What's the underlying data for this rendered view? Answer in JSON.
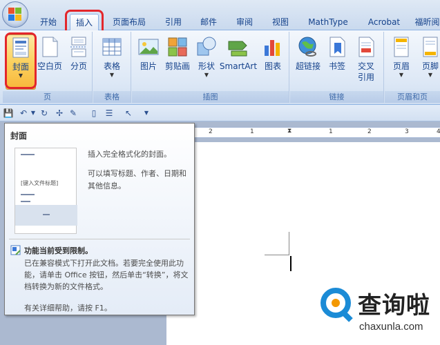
{
  "tabs": {
    "home": "开始",
    "insert": "插入",
    "page_layout": "页面布局",
    "references": "引用",
    "mailings": "邮件",
    "review": "审阅",
    "view": "视图",
    "mathtype": "MathType",
    "acrobat": "Acrobat",
    "foxit": "福昕阅"
  },
  "ribbon": {
    "pages_group": {
      "label": "页",
      "cover": "封面",
      "blank_page": "空白页",
      "page_break": "分页"
    },
    "tables_group": {
      "label": "表格",
      "table": "表格"
    },
    "illustrations_group": {
      "label": "插图",
      "picture": "图片",
      "clip_art": "剪贴画",
      "shapes": "形状",
      "smartart": "SmartArt",
      "chart": "图表"
    },
    "links_group": {
      "label": "链接",
      "hyperlink": "超链接",
      "bookmark": "书签",
      "cross_ref_1": "交叉",
      "cross_ref_2": "引用"
    },
    "header_footer_group": {
      "label": "页眉和页",
      "header": "页眉",
      "footer": "页脚"
    }
  },
  "ruler": {
    "ticks": [
      "2",
      "1",
      "1",
      "2",
      "3",
      "4"
    ]
  },
  "tooltip": {
    "title": "封面",
    "thumb_heading": "[键入文件标题]",
    "desc_1": "插入完全格式化的封面。",
    "desc_2": "可以填写标题、作者、日期和其他信息。",
    "warn_title": "功能当前受到限制。",
    "warn_body": "已在兼容模式下打开此文档。若要完全使用此功能，请单击 Office 按钮，然后单击“转换”，将文档转换为新的文件格式。",
    "help": "有关详细帮助，请按 F1。"
  },
  "watermark": {
    "cn": "查询啦",
    "en": "chaxunla.com"
  },
  "colors": {
    "highlight": "#e3262b",
    "ribbon_text": "#15428b",
    "pressed": "#fbd15f",
    "brand_blue": "#1b8bd6",
    "brand_orange": "#f39800"
  }
}
